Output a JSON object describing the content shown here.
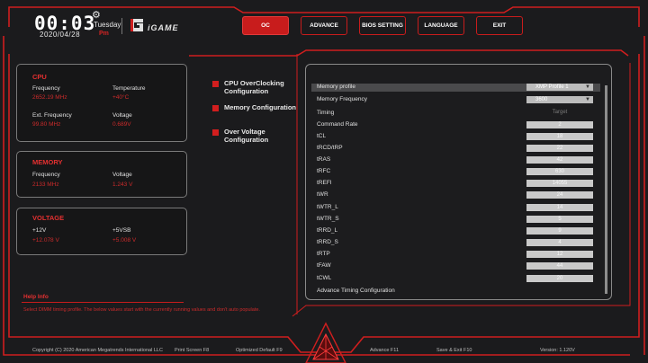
{
  "header": {
    "time": "00:03",
    "weekday": "Tuesday",
    "ampm": "Pm",
    "date": "2020/04/28",
    "brand": "iGAME"
  },
  "tabs": [
    {
      "label": "OC",
      "active": true
    },
    {
      "label": "ADVANCE",
      "active": false
    },
    {
      "label": "BIOS SETTING",
      "active": false
    },
    {
      "label": "LANGUAGE",
      "active": false
    },
    {
      "label": "EXIT",
      "active": false
    }
  ],
  "cpu": {
    "title": "CPU",
    "frequency_label": "Frequency",
    "frequency_value": "2652.19 MHz",
    "temperature_label": "Temperature",
    "temperature_value": "+40°C",
    "ext_frequency_label": "Ext. Frequency",
    "ext_frequency_value": "99.80 MHz",
    "voltage_label": "Voltage",
    "voltage_value": "0.689V"
  },
  "memory": {
    "title": "MEMORY",
    "frequency_label": "Frequency",
    "frequency_value": "2133 MHz",
    "voltage_label": "Voltage",
    "voltage_value": "1.243 V"
  },
  "voltage": {
    "title": "VOLTAGE",
    "v12_label": "+12V",
    "v12_value": "+12.078 V",
    "v5_label": "+5VSB",
    "v5_value": "+5.008 V"
  },
  "menu": [
    {
      "label": "CPU OverClocking Configuration"
    },
    {
      "label": "Memory Configuration"
    },
    {
      "label": "Over Voltage Configuration"
    }
  ],
  "settings": {
    "memory_profile": {
      "label": "Memory profile",
      "value": "XMP Profile 1"
    },
    "memory_frequency": {
      "label": "Memory Frequency",
      "value": "3600"
    },
    "timing": {
      "label": "Timing",
      "value": "Target"
    },
    "rows": [
      {
        "label": "Command Rate",
        "value": "2"
      },
      {
        "label": "tCL",
        "value": "18"
      },
      {
        "label": "tRCD/tRP",
        "value": "22"
      },
      {
        "label": "tRAS",
        "value": "42"
      },
      {
        "label": "tRFC",
        "value": "630"
      },
      {
        "label": "tREFI",
        "value": "14055"
      },
      {
        "label": "tWR",
        "value": "24"
      },
      {
        "label": "tWTR_L",
        "value": "14"
      },
      {
        "label": "tWTR_S",
        "value": "5"
      },
      {
        "label": "tRRD_L",
        "value": "9"
      },
      {
        "label": "tRRD_S",
        "value": "4"
      },
      {
        "label": "tRTP",
        "value": "12"
      },
      {
        "label": "tFAW",
        "value": "44"
      },
      {
        "label": "tCWL",
        "value": "20"
      }
    ],
    "advanced_link": "Advance Timing Configuration"
  },
  "help": {
    "title": "Help Info",
    "text": "Select DIMM timing profile. The below values start with the currently running values and don't auto populate."
  },
  "footer": {
    "copyright": "Copyright (C) 2020 American Megatrends International LLC",
    "print_screen": "Print Screen F8",
    "optimized_default": "Optimized Default F9",
    "advance": "Advance F11",
    "save_exit": "Save & Exit F10",
    "version": "Version: 1.120V"
  },
  "colors": {
    "accent": "#c81c1c",
    "background": "#1b1b1d",
    "panel_border": "#7a7a7a",
    "value_text": "#cc2b2b"
  }
}
